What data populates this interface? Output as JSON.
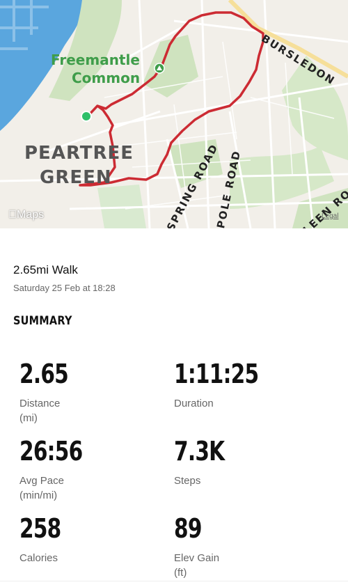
{
  "map": {
    "place_labels": {
      "peartree_1": "PEARTREE",
      "peartree_2": "GREEN",
      "freemantle_1": "Freemantle",
      "freemantle_2": "Common"
    },
    "road_labels": {
      "bursledon": "BURSLEDON",
      "spring": "SPRING ROAD",
      "pole": "POLE ROAD",
      "leen": "LEEN RO"
    },
    "attribution": "Maps",
    "legal": "Legal",
    "colors": {
      "water": "#5aa6de",
      "green": "#cfe3bf",
      "route": "#cc2b33",
      "start": "#2fc06a"
    }
  },
  "activity": {
    "title": "2.65mi Walk",
    "datetime": "Saturday 25 Feb at 18:28"
  },
  "summary": {
    "heading": "SUMMARY",
    "distance": {
      "value": "2.65",
      "label": "Distance",
      "unit": "(mi)"
    },
    "duration": {
      "value": "1:11:25",
      "label": "Duration"
    },
    "avg_pace": {
      "value": "26:56",
      "label": "Avg Pace",
      "unit": "(min/mi)"
    },
    "steps": {
      "value": "7.3K",
      "label": "Steps"
    },
    "calories": {
      "value": "258",
      "label": "Calories"
    },
    "elev_gain": {
      "value": "89",
      "label": "Elev Gain",
      "unit": "(ft)"
    }
  }
}
